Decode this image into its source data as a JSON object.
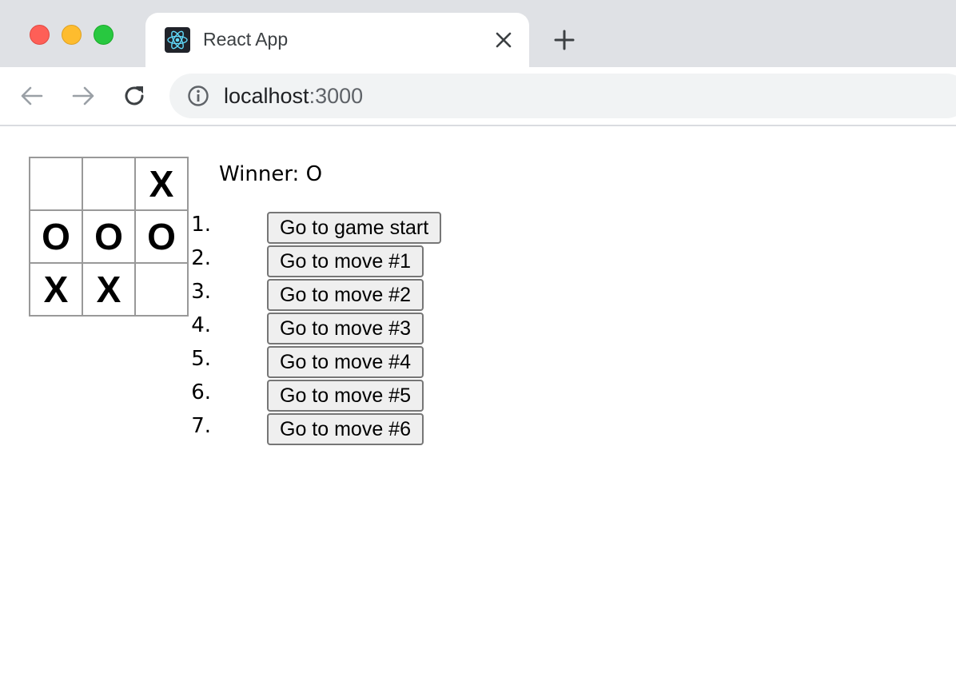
{
  "browser": {
    "tab": {
      "title": "React App",
      "favicon": "react-logo-icon"
    },
    "address": {
      "host": "localhost",
      "port": ":3000"
    }
  },
  "game": {
    "board": [
      "",
      "",
      "X",
      "O",
      "O",
      "O",
      "X",
      "X",
      ""
    ],
    "status": "Winner: O",
    "moves": [
      {
        "number": "1.",
        "label": "Go to game start"
      },
      {
        "number": "2.",
        "label": "Go to move #1"
      },
      {
        "number": "3.",
        "label": "Go to move #2"
      },
      {
        "number": "4.",
        "label": "Go to move #3"
      },
      {
        "number": "5.",
        "label": "Go to move #4"
      },
      {
        "number": "6.",
        "label": "Go to move #5"
      },
      {
        "number": "7.",
        "label": "Go to move #6"
      }
    ]
  }
}
